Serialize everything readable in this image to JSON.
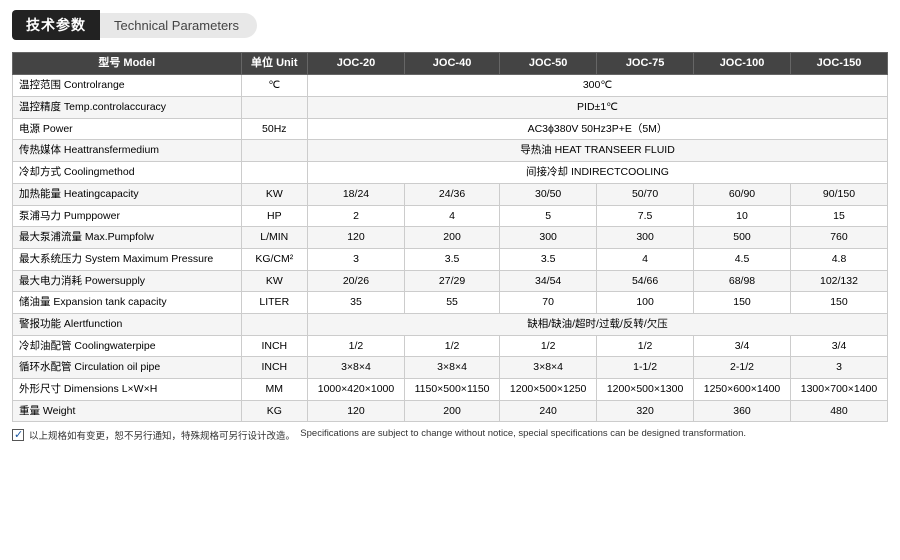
{
  "header": {
    "badge": "技术参数",
    "title": "Technical Parameters"
  },
  "table": {
    "columns": [
      "型号 Model",
      "单位 Unit",
      "JOC-20",
      "JOC-40",
      "JOC-50",
      "JOC-75",
      "JOC-100",
      "JOC-150"
    ],
    "rows": [
      {
        "label": "温控范围 Controlrange",
        "unit": "℃",
        "values": [
          "300℃",
          null,
          null,
          null,
          null,
          null
        ],
        "span": 6
      },
      {
        "label": "温控精度 Temp.controlaccuracy",
        "unit": "",
        "values": [
          "PID±1℃",
          null,
          null,
          null,
          null,
          null
        ],
        "span": 6
      },
      {
        "label": "电源 Power",
        "unit": "50Hz",
        "values": [
          "AC3ϕ380V 50Hz3P+E（5M）",
          null,
          null,
          null,
          null,
          null
        ],
        "span": 6
      },
      {
        "label": "传热媒体 Heattransfermedium",
        "unit": "",
        "values": [
          "导热油 HEAT TRANSEER FLUID",
          null,
          null,
          null,
          null,
          null
        ],
        "span": 6
      },
      {
        "label": "冷却方式 Coolingmethod",
        "unit": "",
        "values": [
          "间接冷却 INDIRECTCOOLING",
          null,
          null,
          null,
          null,
          null
        ],
        "span": 6
      },
      {
        "label": "加热能量 Heatingcapacity",
        "unit": "KW",
        "values": [
          "18/24",
          "24/36",
          "30/50",
          "50/70",
          "60/90",
          "90/150"
        ],
        "span": null
      },
      {
        "label": "泵浦马力 Pumppower",
        "unit": "HP",
        "values": [
          "2",
          "4",
          "5",
          "7.5",
          "10",
          "15"
        ],
        "span": null
      },
      {
        "label": "最大泵浦流量 Max.Pumpfolw",
        "unit": "L/MIN",
        "values": [
          "120",
          "200",
          "300",
          "300",
          "500",
          "760"
        ],
        "span": null
      },
      {
        "label": "最大系统压力 System Maximum Pressure",
        "unit": "KG/CM²",
        "values": [
          "3",
          "3.5",
          "3.5",
          "4",
          "4.5",
          "4.8"
        ],
        "span": null
      },
      {
        "label": "最大电力消耗 Powersupply",
        "unit": "KW",
        "values": [
          "20/26",
          "27/29",
          "34/54",
          "54/66",
          "68/98",
          "102/132"
        ],
        "span": null
      },
      {
        "label": "储油量 Expansion tank capacity",
        "unit": "LITER",
        "values": [
          "35",
          "55",
          "70",
          "100",
          "150",
          "150"
        ],
        "span": null
      },
      {
        "label": "警报功能 Alertfunction",
        "unit": "",
        "values": [
          "缺相/缺油/超时/过载/反转/欠压",
          null,
          null,
          null,
          null,
          null
        ],
        "span": 6
      },
      {
        "label": "冷却油配管 Coolingwaterpipe",
        "unit": "INCH",
        "values": [
          "1/2",
          "1/2",
          "1/2",
          "1/2",
          "3/4",
          "3/4"
        ],
        "span": null
      },
      {
        "label": "循环水配管 Circulation oil pipe",
        "unit": "INCH",
        "values": [
          "3×8×4",
          "3×8×4",
          "3×8×4",
          "1-1/2",
          "2-1/2",
          "3"
        ],
        "span": null
      },
      {
        "label": "外形尺寸 Dimensions L×W×H",
        "unit": "MM",
        "values": [
          "1000×420×1000",
          "1150×500×1150",
          "1200×500×1250",
          "1200×500×1300",
          "1250×600×1400",
          "1300×700×1400"
        ],
        "span": null
      },
      {
        "label": "重量 Weight",
        "unit": "KG",
        "values": [
          "120",
          "200",
          "240",
          "320",
          "360",
          "480"
        ],
        "span": null
      }
    ]
  },
  "footer": {
    "note_cn": "以上规格如有变更，恕不另行通知，特殊规格可另行设计改造。",
    "note_en": "Specifications are subject to change without notice, special specifications can be designed transformation."
  }
}
